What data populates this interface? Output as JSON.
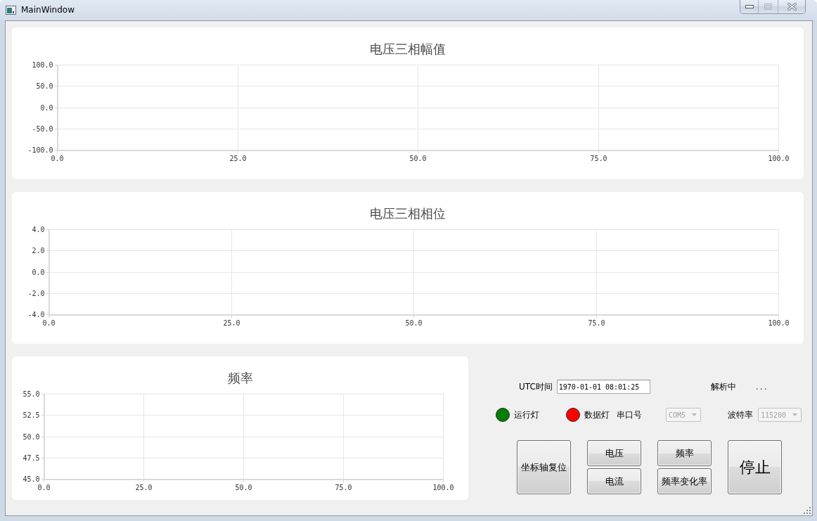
{
  "window": {
    "title": "MainWindow",
    "maximize_disabled": true
  },
  "charts": [
    {
      "chart_data": {
        "type": "line",
        "title": "电压三相幅值",
        "grid": true,
        "xlim": [
          0,
          100
        ],
        "ylim": [
          -100,
          100
        ],
        "xticks": [
          {
            "value": 0,
            "label": "0.0"
          },
          {
            "value": 25,
            "label": "25.0"
          },
          {
            "value": 50,
            "label": "50.0"
          },
          {
            "value": 75,
            "label": "75.0"
          },
          {
            "value": 100,
            "label": "100.0"
          }
        ],
        "yticks": [
          {
            "value": 100,
            "label": "100.0"
          },
          {
            "value": 50,
            "label": "50.0"
          },
          {
            "value": 0,
            "label": "0.0"
          },
          {
            "value": -50,
            "label": "-50.0"
          },
          {
            "value": -100,
            "label": "-100.0"
          }
        ]
      }
    },
    {
      "chart_data": {
        "type": "line",
        "title": "电压三相相位",
        "grid": true,
        "xlim": [
          0,
          100
        ],
        "ylim": [
          -4,
          4
        ],
        "xticks": [
          {
            "value": 0,
            "label": "0.0"
          },
          {
            "value": 25,
            "label": "25.0"
          },
          {
            "value": 50,
            "label": "50.0"
          },
          {
            "value": 75,
            "label": "75.0"
          },
          {
            "value": 100,
            "label": "100.0"
          }
        ],
        "yticks": [
          {
            "value": 4,
            "label": "4.0"
          },
          {
            "value": 2,
            "label": "2.0"
          },
          {
            "value": 0,
            "label": "0.0"
          },
          {
            "value": -2,
            "label": "-2.0"
          },
          {
            "value": -4,
            "label": "-4.0"
          }
        ]
      }
    },
    {
      "chart_data": {
        "type": "line",
        "title": "频率",
        "grid": true,
        "xlim": [
          0,
          100
        ],
        "ylim": [
          45,
          55
        ],
        "xticks": [
          {
            "value": 0,
            "label": "0.0"
          },
          {
            "value": 25,
            "label": "25.0"
          },
          {
            "value": 50,
            "label": "50.0"
          },
          {
            "value": 75,
            "label": "75.0"
          },
          {
            "value": 100,
            "label": "100.0"
          }
        ],
        "yticks": [
          {
            "value": 55,
            "label": "55.0"
          },
          {
            "value": 52.5,
            "label": "52.5"
          },
          {
            "value": 50,
            "label": "50.0"
          },
          {
            "value": 47.5,
            "label": "47.5"
          },
          {
            "value": 45,
            "label": "45.0"
          }
        ]
      }
    }
  ],
  "utc_time": {
    "label": "UTC时间",
    "value": "1970-01-01 08:01:25"
  },
  "parse_status": {
    "label": "解析中",
    "value": "..."
  },
  "lamps": [
    {
      "label": "运行灯",
      "color": "#007f00"
    },
    {
      "label": "数据灯",
      "color": "#ff0000"
    }
  ],
  "serial_port": {
    "label": "串口号",
    "value": "COM5",
    "disabled": true
  },
  "baud_rate": {
    "label": "波特率",
    "value": "115200",
    "disabled": true
  },
  "button_columns": [
    {
      "buttons": [
        {
          "label": "坐标轴复位",
          "kind": "normal"
        }
      ]
    },
    {
      "buttons": [
        {
          "label": "电压",
          "kind": "normal"
        },
        {
          "label": "电流",
          "kind": "normal"
        }
      ]
    },
    {
      "buttons": [
        {
          "label": "频率",
          "kind": "normal"
        },
        {
          "label": "频率变化率",
          "kind": "normal"
        }
      ]
    },
    {
      "buttons": [
        {
          "label": "停止",
          "kind": "large"
        }
      ]
    }
  ]
}
